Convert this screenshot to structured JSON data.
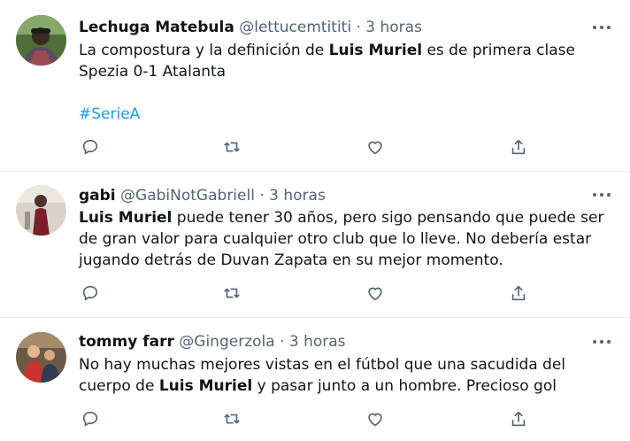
{
  "tweets": [
    {
      "name": "Lechuga Matebula",
      "handle": "@lettucemtititi",
      "sep": "·",
      "time": "3 horas",
      "line1": {
        "pre": "La compostura y la definición de ",
        "bold": "Luis Muriel",
        "post": " es de primera clase"
      },
      "line2": "Spezia 0-1 Atalanta",
      "hashtag": "#SerieA"
    },
    {
      "name": "gabi",
      "handle": "@GabiNotGabriell",
      "sep": "·",
      "time": "3 horas",
      "bold": "Luis Muriel",
      "post": " puede tener 30 años, pero sigo pensando que puede ser de gran valor para cualquier otro club que lo lleve. No debería estar jugando detrás de Duvan Zapata en su mejor momento."
    },
    {
      "name": "tommy farr",
      "handle": "@Gingerzola",
      "sep": "·",
      "time": "3 horas",
      "pre": "No hay muchas mejores vistas en el fútbol que una sacudida del cuerpo de ",
      "bold": "Luis Muriel",
      "post": " y pasar junto a un hombre. Precioso gol"
    }
  ],
  "icons": {
    "reply": "reply-icon",
    "retweet": "retweet-icon",
    "like": "like-icon",
    "share": "share-icon",
    "more": "more-icon"
  },
  "colors": {
    "text": "#0f1419",
    "secondary": "#536471",
    "link": "#1d9bf0",
    "divider": "#e7e9ea"
  }
}
